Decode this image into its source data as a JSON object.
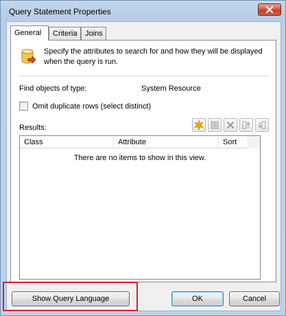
{
  "window": {
    "title": "Query Statement Properties",
    "close_glyph": "✕"
  },
  "tabs": [
    {
      "label": "General",
      "selected": true
    },
    {
      "label": "Criteria",
      "selected": false
    },
    {
      "label": "Joins",
      "selected": false
    }
  ],
  "general": {
    "intro_text": "Specify the attributes to search for and how they will be displayed when the query is run.",
    "find_label": "Find objects of type:",
    "find_value": "System Resource",
    "omit_label": "Omit duplicate rows (select distinct)",
    "omit_checked": false,
    "results_label": "Results:",
    "toolbar_icons": [
      "new-star-icon",
      "properties-icon",
      "delete-icon",
      "move-up-icon",
      "move-down-icon"
    ]
  },
  "results_list": {
    "columns": [
      "Class",
      "Attribute",
      "Sort"
    ],
    "empty_text": "There are no items to show in this view."
  },
  "buttons": {
    "show_query_language": "Show Query Language",
    "ok": "OK",
    "cancel": "Cancel"
  },
  "colors": {
    "highlight": "#d6222c",
    "star": "#f5a300"
  }
}
